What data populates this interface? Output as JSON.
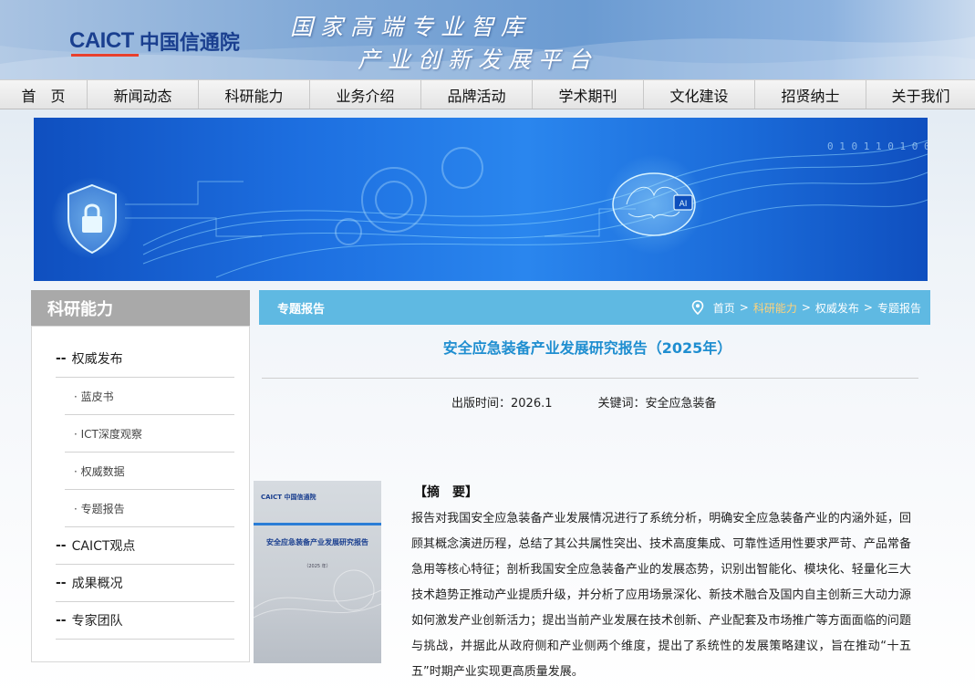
{
  "header": {
    "logo_mark": "CAICT",
    "logo_cn": "中国信通院",
    "slogan_line1": "国家高端专业智库",
    "slogan_line2": "产业创新发展平台"
  },
  "nav": {
    "items": [
      "首　页",
      "新闻动态",
      "科研能力",
      "业务介绍",
      "品牌活动",
      "学术期刊",
      "文化建设",
      "招贤纳士",
      "关于我们"
    ]
  },
  "banner": {
    "code_text": "0 1 0 1 1 0 1 0 0 1 1 0",
    "chip_text": "AI"
  },
  "sidebar": {
    "title": "科研能力",
    "items": [
      {
        "label": "权威发布",
        "level": 1
      },
      {
        "label": "· 蓝皮书",
        "level": 2
      },
      {
        "label": "· ICT深度观察",
        "level": 2
      },
      {
        "label": "· 权威数据",
        "level": 2
      },
      {
        "label": "· 专题报告",
        "level": 2
      },
      {
        "label": "CAICT观点",
        "level": 1
      },
      {
        "label": "成果概况",
        "level": 1
      },
      {
        "label": "专家团队",
        "level": 1
      }
    ],
    "dash": "--"
  },
  "content": {
    "section_title": "专题报告",
    "breadcrumb": [
      "首页",
      "科研能力",
      "权威发布",
      "专题报告"
    ],
    "breadcrumb_sep": ">",
    "doc_title": "安全应急装备产业发展研究报告（2025年）",
    "publish_label": "出版时间：2026.1",
    "keyword_label": "关键词：安全应急装备",
    "cover": {
      "logo": "CAICT 中国信通院",
      "title": "安全应急装备产业发展研究报告",
      "year": "（2025 年）"
    },
    "abstract_heading": "【摘　要】",
    "abstract_text": "报告对我国安全应急装备产业发展情况进行了系统分析，明确安全应急装备产业的内涵外延，回顾其概念演进历程，总结了其公共属性突出、技术高度集成、可靠性适用性要求严苛、产品常备急用等核心特征；剖析我国安全应急装备产业的发展态势，识别出智能化、模块化、轻量化三大技术趋势正推动产业提质升级，并分析了应用场景深化、新技术融合及国内自主创新三大动力源如何激发产业创新活力；提出当前产业发展在技术创新、产业配套及市场推广等方面面临的问题与挑战，并据此从政府侧和产业侧两个维度，提出了系统性的发展策略建议，旨在推动“十五五”时期产业实现更高质量发展。"
  },
  "colors": {
    "nav_bg": "#e8e8e8",
    "breadcrumb_bar": "#5fb9e2",
    "title_blue": "#1f8ed0",
    "sidebar_head": "#a9a9a9",
    "active_crumb": "#ffd27a"
  },
  "icons": {
    "location": "map-pin-icon",
    "banner_shield": "shield-lock-icon",
    "banner_brain": "brain-ai-icon"
  }
}
